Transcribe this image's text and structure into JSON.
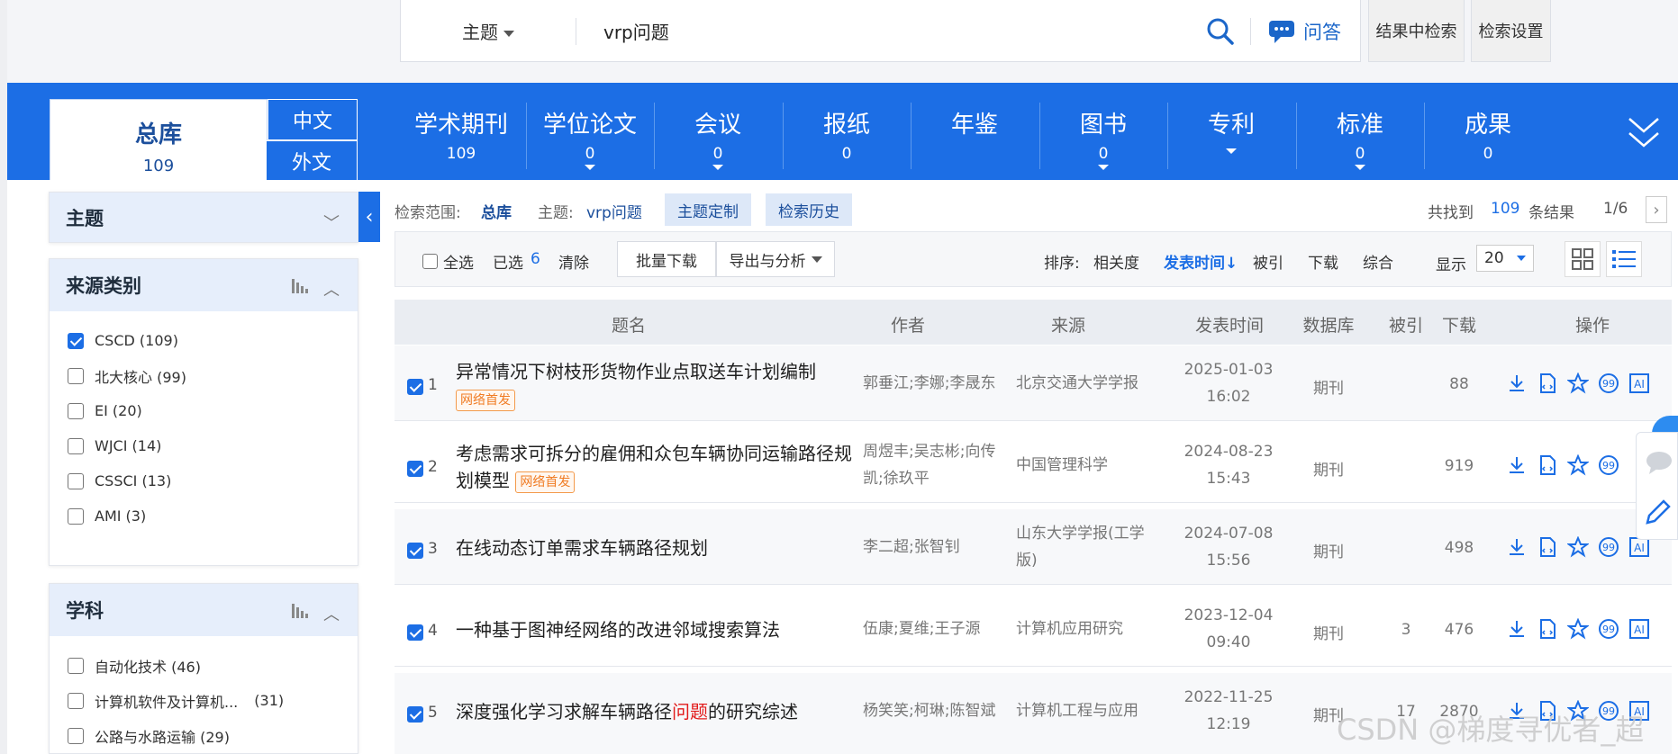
{
  "search": {
    "type": "主题",
    "query": "vrp问题",
    "qa": "问答",
    "in_results": "结果中检索",
    "settings": "检索设置"
  },
  "tabs": {
    "total": {
      "label": "总库",
      "count": "109",
      "zh": "中文",
      "en": "外文"
    },
    "categories": [
      {
        "label": "学术期刊",
        "count": "109"
      },
      {
        "label": "学位论文",
        "count": "0"
      },
      {
        "label": "会议",
        "count": "0"
      },
      {
        "label": "报纸",
        "count": "0"
      },
      {
        "label": "年鉴",
        "count": ""
      },
      {
        "label": "图书",
        "count": "0"
      },
      {
        "label": "专利",
        "count": ""
      },
      {
        "label": "标准",
        "count": "0"
      },
      {
        "label": "成果",
        "count": "0"
      }
    ]
  },
  "sidebar": {
    "topic": {
      "title": "主题"
    },
    "source": {
      "title": "来源类别",
      "items": [
        {
          "label": "CSCD (109)",
          "checked": true
        },
        {
          "label": "北大核心 (99)",
          "checked": false
        },
        {
          "label": "EI (20)",
          "checked": false
        },
        {
          "label": "WJCI (14)",
          "checked": false
        },
        {
          "label": "CSSCI (13)",
          "checked": false
        },
        {
          "label": "AMI (3)",
          "checked": false
        }
      ]
    },
    "subject": {
      "title": "学科",
      "items": [
        {
          "label": "自动化技术 (46)"
        },
        {
          "label": "计算机软件及计算机...",
          "count": "(31)"
        },
        {
          "label": "公路与水路运输 (29)"
        }
      ]
    }
  },
  "meta": {
    "scope_label": "检索范围:",
    "scope_value": "总库",
    "topic_label": "主题:",
    "topic_value": "vrp问题",
    "custom": "主题定制",
    "history": "检索历史",
    "found": "共找到",
    "total": "109",
    "results": "条结果",
    "page": "1/6"
  },
  "toolbar": {
    "select_all": "全选",
    "selected_label": "已选",
    "selected_count": "6",
    "clear": "清除",
    "batch_download": "批量下载",
    "export": "导出与分析",
    "sort_label": "排序:",
    "sort_relevance": "相关度",
    "sort_date": "发表时间",
    "sort_cited": "被引",
    "sort_download": "下载",
    "sort_combined": "综合",
    "show_label": "显示",
    "show_value": "20"
  },
  "table": {
    "headers": {
      "title": "题名",
      "author": "作者",
      "source": "来源",
      "date": "发表时间",
      "db": "数据库",
      "cited": "被引",
      "downloads": "下载",
      "ops": "操作"
    },
    "rows": [
      {
        "n": "1",
        "title": "异常情况下树枝形货物作业点取送车计划编制",
        "badge": "网络首发",
        "authors": "郭垂江;李娜;李晟东",
        "source": "北京交通大学学报",
        "date": "2025-01-03",
        "time": "16:02",
        "db": "期刊",
        "cited": "",
        "downloads": "88"
      },
      {
        "n": "2",
        "title": "考虑需求可拆分的雇佣和众包车辆协同运输路径规划模型",
        "badge": "网络首发",
        "authors": "周煜丰;吴志彬;向传凯;徐玖平",
        "source": "中国管理科学",
        "date": "2024-08-23",
        "time": "15:43",
        "db": "期刊",
        "cited": "",
        "downloads": "919"
      },
      {
        "n": "3",
        "title": "在线动态订单需求车辆路径规划",
        "badge": "",
        "authors": "李二超;张智钊",
        "source": "山东大学学报(工学版)",
        "date": "2024-07-08",
        "time": "15:56",
        "db": "期刊",
        "cited": "",
        "downloads": "498"
      },
      {
        "n": "4",
        "title": "一种基于图神经网络的改进邻域搜索算法",
        "badge": "",
        "authors": "伍康;夏维;王子源",
        "source": "计算机应用研究",
        "date": "2023-12-04",
        "time": "09:40",
        "db": "期刊",
        "cited": "3",
        "downloads": "476"
      },
      {
        "n": "5",
        "title_pre": "深度强化学习求解车辆路径",
        "title_hl": "问题",
        "title_post": "的研究综述",
        "authors": "杨笑笑;柯琳;陈智斌",
        "source": "计算机工程与应用",
        "date": "2022-11-25",
        "time": "12:19",
        "db": "期刊",
        "cited": "17",
        "downloads": "2870"
      }
    ]
  },
  "watermark": "CSDN @梯度寻优者_超",
  "colors": {
    "accent": "#1c6ee5",
    "badge": "#f07c24",
    "highlight": "#e21b1b"
  }
}
